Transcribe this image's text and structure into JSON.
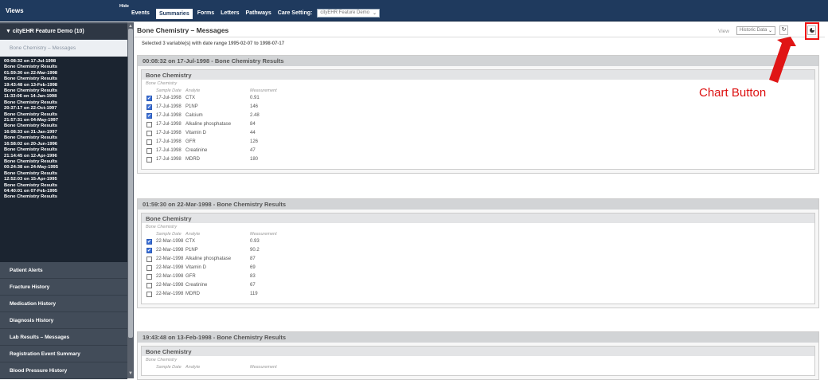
{
  "topbar": {
    "views_title": "Views",
    "hide_label": "Hide",
    "nav": [
      "Events",
      "Summaries",
      "Forms",
      "Letters",
      "Pathways",
      "Care Setting:"
    ],
    "active_nav": "Summaries",
    "care_setting_value": "cityEHR Feature Demo"
  },
  "sidebar": {
    "header": "▼ cityEHR Feature Demo (10)",
    "current_view": "Bone Chemistry – Messages",
    "entries": [
      {
        "time": "00:08:32 on 17-Jul-1998",
        "label": "Bone Chemistry Results"
      },
      {
        "time": "01:59:30 on 22-Mar-1998",
        "label": "Bone Chemistry Results"
      },
      {
        "time": "19:43:48 on 13-Feb-1998",
        "label": "Bone Chemistry Results"
      },
      {
        "time": "11:33:06 on 14-Jan-1998",
        "label": "Bone Chemistry Results"
      },
      {
        "time": "20:37:17 on 22-Oct-1997",
        "label": "Bone Chemistry Results"
      },
      {
        "time": "21:57:31 on 04-May-1997",
        "label": "Bone Chemistry Results"
      },
      {
        "time": "16:08:33 on 31-Jan-1997",
        "label": "Bone Chemistry Results"
      },
      {
        "time": "16:58:02 on 20-Jun-1996",
        "label": "Bone Chemistry Results"
      },
      {
        "time": "21:14:45 on 12-Apr-1996",
        "label": "Bone Chemistry Results"
      },
      {
        "time": "00:24:38 on 24-May-1995",
        "label": "Bone Chemistry Results"
      },
      {
        "time": "12:52:03 on 15-Apr-1995",
        "label": "Bone Chemistry Results"
      },
      {
        "time": "04:40:01 on 07-Feb-1995",
        "label": "Bone Chemistry Results"
      }
    ],
    "sections": [
      "Patient Alerts",
      "Fracture History",
      "Medication History",
      "Diagnosis History",
      "Lab Results – Messages",
      "Registration Event Summary",
      "Blood Pressure History"
    ]
  },
  "main": {
    "title": "Bone Chemistry – Messages",
    "view_label": "View",
    "view_value": "Historic Data",
    "selected_note": "Selected 3 variable(s) with date range 1995-02-07 to 1998-07-17",
    "columns": {
      "date": "Sample Date",
      "analyte": "Analyte",
      "measurement": "Measurement"
    },
    "summaries": [
      {
        "heading": "00:08:32 on 17-Jul-1998 - Bone Chemistry Results",
        "group": "Bone Chemistry",
        "sub": "Bone Chemistry",
        "rows": [
          {
            "date": "17-Jul-1998",
            "analyte": "CTX",
            "value": "0.91",
            "checked": true
          },
          {
            "date": "17-Jul-1998",
            "analyte": "P1NP",
            "value": "146",
            "checked": true
          },
          {
            "date": "17-Jul-1998",
            "analyte": "Calcium",
            "value": "2.48",
            "checked": true
          },
          {
            "date": "17-Jul-1998",
            "analyte": "Alkaline phosphatase",
            "value": "84",
            "checked": false
          },
          {
            "date": "17-Jul-1998",
            "analyte": "Vitamin D",
            "value": "44",
            "checked": false
          },
          {
            "date": "17-Jul-1998",
            "analyte": "GFR",
            "value": "126",
            "checked": false
          },
          {
            "date": "17-Jul-1998",
            "analyte": "Creatinine",
            "value": "47",
            "checked": false
          },
          {
            "date": "17-Jul-1998",
            "analyte": "MDRD",
            "value": "180",
            "checked": false
          }
        ]
      },
      {
        "heading": "01:59:30 on 22-Mar-1998 - Bone Chemistry Results",
        "group": "Bone Chemistry",
        "sub": "Bone Chemistry",
        "rows": [
          {
            "date": "22-Mar-1998",
            "analyte": "CTX",
            "value": "0.93",
            "checked": true
          },
          {
            "date": "22-Mar-1998",
            "analyte": "P1NP",
            "value": "90.2",
            "checked": true
          },
          {
            "date": "22-Mar-1998",
            "analyte": "Alkaline phosphatase",
            "value": "87",
            "checked": false
          },
          {
            "date": "22-Mar-1998",
            "analyte": "Vitamin D",
            "value": "69",
            "checked": false
          },
          {
            "date": "22-Mar-1998",
            "analyte": "GFR",
            "value": "83",
            "checked": false
          },
          {
            "date": "22-Mar-1998",
            "analyte": "Creatinine",
            "value": "67",
            "checked": false
          },
          {
            "date": "22-Mar-1998",
            "analyte": "MDRD",
            "value": "119",
            "checked": false
          }
        ]
      },
      {
        "heading": "19:43:48 on 13-Feb-1998 - Bone Chemistry Results",
        "group": "Bone Chemistry",
        "sub": "Bone Chemistry",
        "rows": []
      }
    ]
  },
  "annotation": {
    "callout_text": "Chart Button",
    "color": "#dd1111"
  },
  "icons": {
    "refresh": "refresh-icon",
    "chart": "chart-icon",
    "checkbox_checked": "✔"
  }
}
